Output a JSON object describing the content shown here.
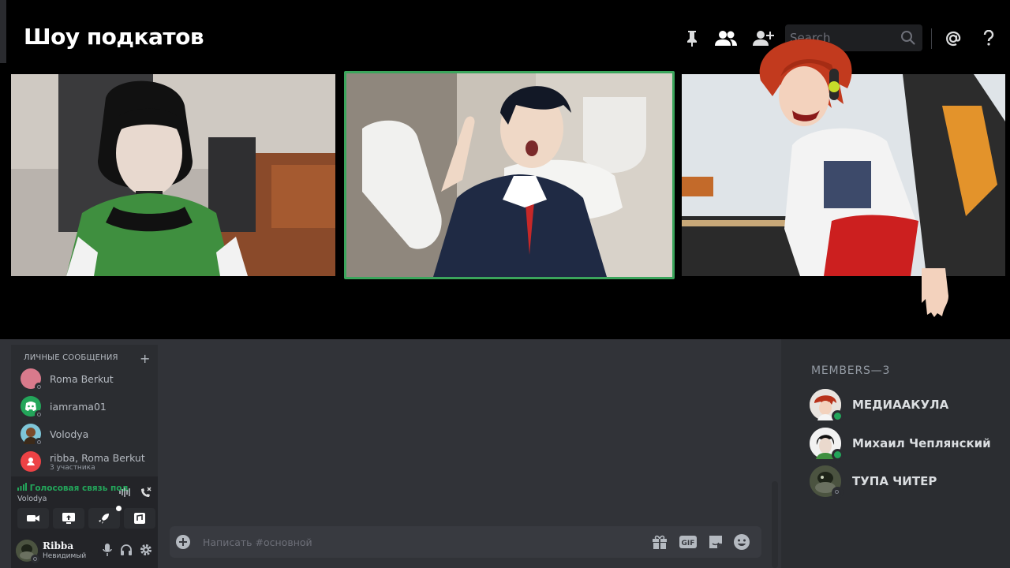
{
  "header": {
    "title": "Шоу подкатов",
    "search_placeholder": "Search",
    "icons": [
      "pin-icon",
      "members-icon",
      "add-friend-icon",
      "search-icon",
      "mention-icon",
      "help-icon"
    ]
  },
  "direct_messages": {
    "header": "ЛИЧНЫЕ СООБЩЕНИЯ",
    "add_label": "+",
    "items": [
      {
        "name": "Roma Berkut",
        "avatar_color": "#d97a8c"
      },
      {
        "name": "iamrama01",
        "avatar_color": "#23a55a"
      },
      {
        "name": "Volodya",
        "avatar_color": "#7fc6d8"
      },
      {
        "name": "ribba, Roma Berkut",
        "subtitle": "3 участника",
        "avatar_color": "#ed4245"
      }
    ]
  },
  "voice": {
    "status": "Голосовая связь под",
    "channel": "Volodya"
  },
  "user": {
    "name": "Ribba",
    "status": "Невидимый"
  },
  "chat": {
    "placeholder": "Написать #основной"
  },
  "members": {
    "header": "MEMBERS—3",
    "items": [
      {
        "name": "МЕДИААКУЛА",
        "status": "online"
      },
      {
        "name": "Михаил Чеплянский",
        "status": "online"
      },
      {
        "name": "ТУПА ЧИТЕР",
        "status": "invisible"
      }
    ]
  },
  "colors": {
    "accent_green": "#23a55a",
    "speaking_border": "#3ba55c",
    "panel": "#2b2d31",
    "background": "#313338"
  }
}
